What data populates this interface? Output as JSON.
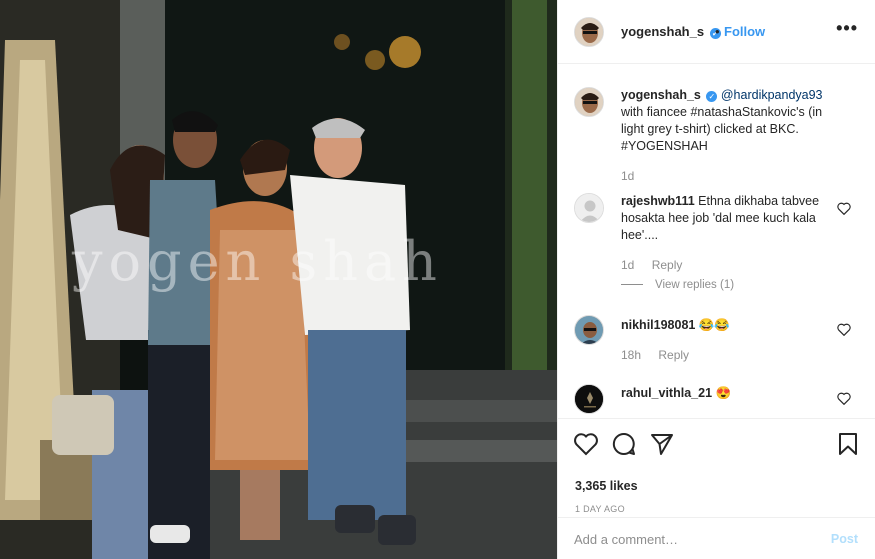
{
  "post": {
    "watermark": "yogen shah"
  },
  "header": {
    "username": "yogenshah_s",
    "separator": "•",
    "follow_label": "Follow",
    "more_icon": "more-options-icon",
    "verified_icon": "verified-badge-icon",
    "accent_color": "#3897f0"
  },
  "caption": {
    "username": "yogenshah_s",
    "mention": "@hardikpandya93",
    "text": "with fiancee #natashaStankovic's (in light grey t-shirt) clicked at BKC. #YOGENSHAH",
    "time": "1d"
  },
  "comments": [
    {
      "username": "rajeshwb111",
      "text": "Ethna dikhaba tabvee hosakta hee job 'dal mee kuch kala hee'....",
      "time": "1d",
      "reply_label": "Reply",
      "view_replies": "View replies (1)"
    },
    {
      "username": "nikhil198081",
      "text": "😂😂",
      "time": "18h",
      "reply_label": "Reply"
    },
    {
      "username": "rahul_vithla_21",
      "text": "😍"
    }
  ],
  "actions": {
    "like_icon": "heart-icon",
    "comment_icon": "comment-icon",
    "share_icon": "share-icon",
    "save_icon": "bookmark-icon",
    "likes": "3,365 likes",
    "time_ago": "1 DAY AGO"
  },
  "add_comment": {
    "placeholder": "Add a comment…",
    "post_label": "Post"
  }
}
